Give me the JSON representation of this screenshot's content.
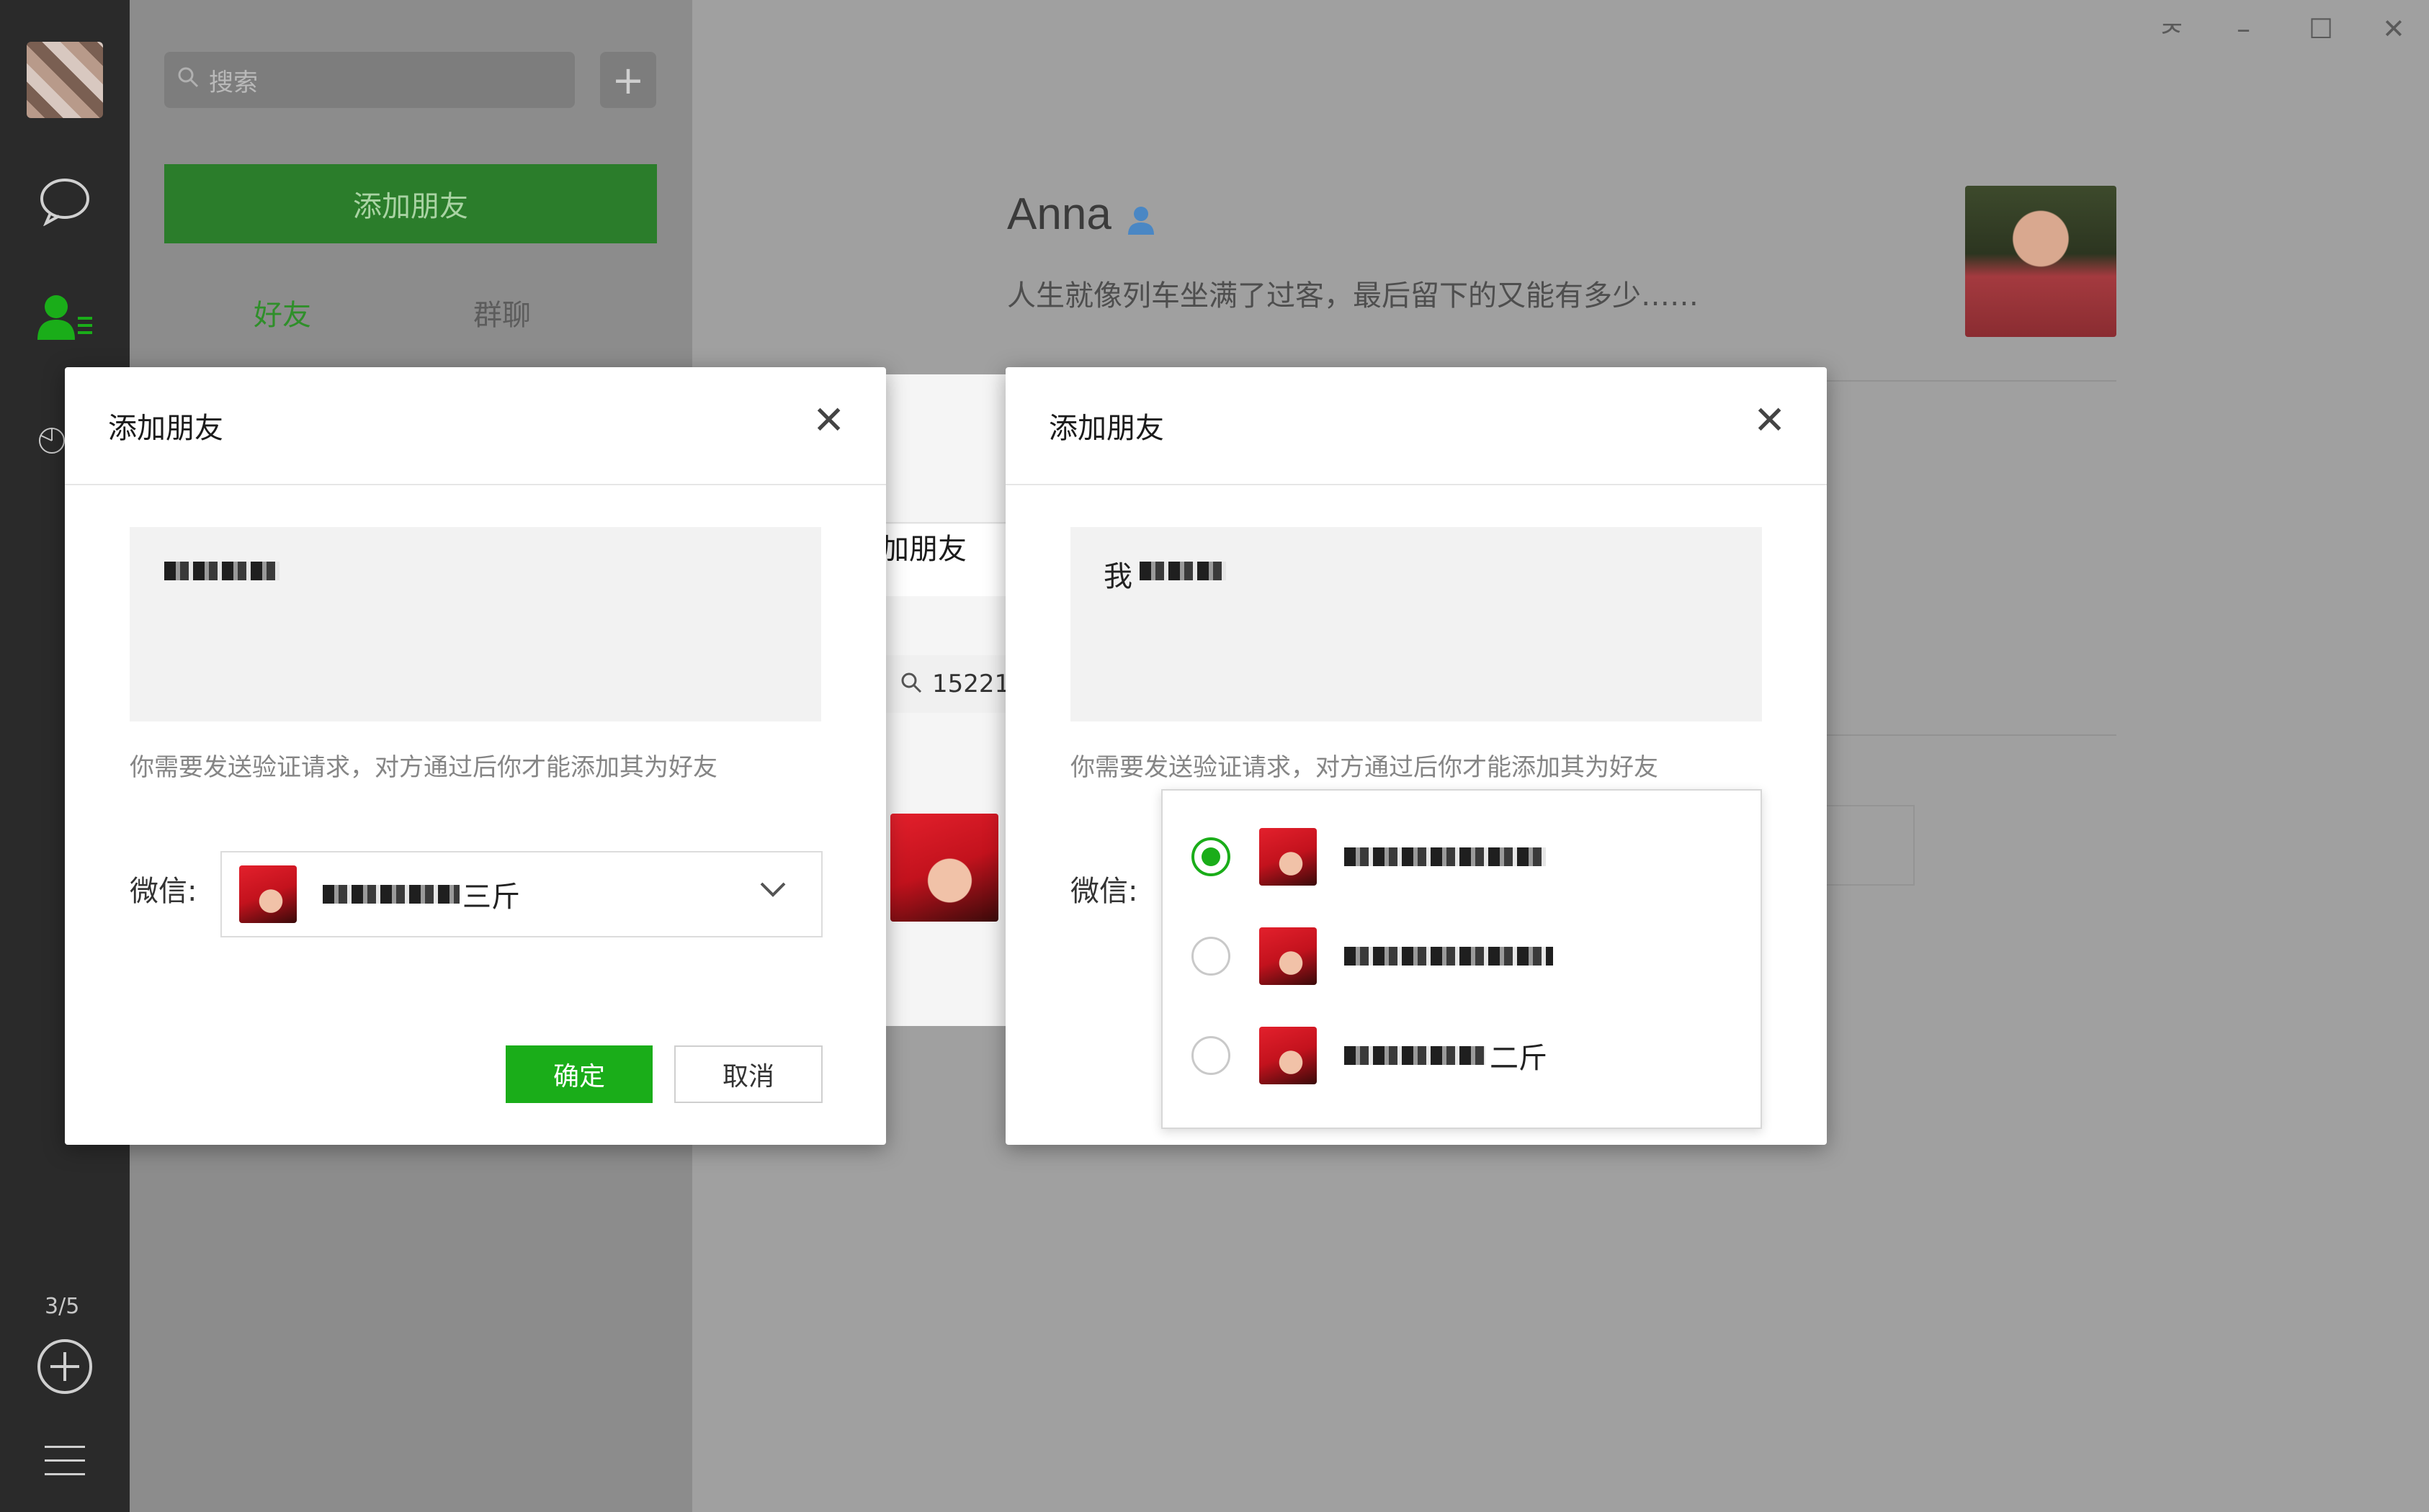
{
  "sidebar": {
    "page_indicator": "3/5"
  },
  "list": {
    "search_placeholder": "搜索",
    "add_button": "+",
    "add_friend_label": "添加朋友",
    "tabs": [
      {
        "label": "好友",
        "active": true
      },
      {
        "label": "群聊",
        "active": false
      }
    ]
  },
  "window_controls": [
    "ᅎ",
    "–",
    "☐",
    "✕"
  ],
  "profile": {
    "name": "Anna",
    "signature": "人生就像列车坐满了过客，最后留下的又能有多少……"
  },
  "back_dialog": {
    "title_fragment": "加朋友",
    "search_fragment": "15221"
  },
  "dialog_left": {
    "title": "添加朋友",
    "message": "",
    "hint": "你需要发送验证请求，对方通过后你才能添加其为好友",
    "wechat_label": "微信:",
    "selected_account_suffix": "三斤",
    "confirm": "确定",
    "cancel": "取消"
  },
  "dialog_right": {
    "title": "添加朋友",
    "message_prefix": "我",
    "hint": "你需要发送验证请求，对方通过后你才能添加其为好友",
    "wechat_label": "微信:",
    "options": [
      {
        "suffix": "",
        "selected": true
      },
      {
        "suffix": "",
        "selected": false
      },
      {
        "suffix": "二斤",
        "selected": false
      }
    ]
  },
  "colors": {
    "accent_green": "#1aad19",
    "sidebar_bg": "#2a2a2a"
  }
}
